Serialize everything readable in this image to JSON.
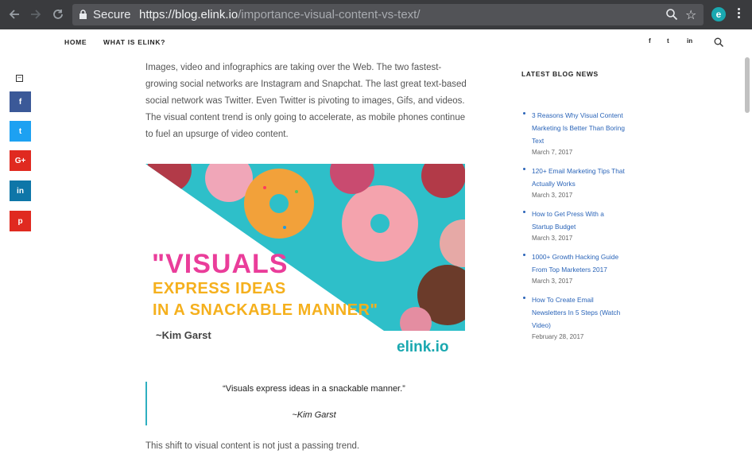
{
  "browser": {
    "secure_label": "Secure",
    "url_host": "https://blog.elink.io",
    "url_path": "/importance-visual-content-vs-text/"
  },
  "site_nav": {
    "links": [
      "HOME",
      "WHAT IS ELINK?"
    ],
    "social": [
      "f",
      "t",
      "in"
    ]
  },
  "share_bar": {
    "buttons": [
      {
        "label": "f",
        "color": "#3b5998"
      },
      {
        "label": "t",
        "color": "#1da1f2"
      },
      {
        "label": "G+",
        "color": "#e02a20"
      },
      {
        "label": "in",
        "color": "#0e76a8"
      },
      {
        "label": "p",
        "color": "#e02a20"
      }
    ]
  },
  "article": {
    "paragraph1": "Images, video and infographics are taking over the Web. The two fastest-growing social networks are Instagram and Snapchat. The last great text-based social network was Twitter. Even Twitter is pivoting to images, Gifs, and videos. The visual content trend is only going to accelerate, as mobile phones continue to fuel an upsurge of video content.",
    "hero": {
      "line1": "\"VISUALS",
      "line2": "EXPRESS IDEAS",
      "line3": "IN A SNACKABLE MANNER\"",
      "author": "~Kim Garst",
      "logo": "elink.io"
    },
    "blockquote_text": "“Visuals express ideas in a snackable manner.”",
    "blockquote_author": "~Kim Garst",
    "paragraph2": "This shift to visual content is not just a passing trend."
  },
  "sidebar": {
    "title": "LATEST BLOG NEWS",
    "items": [
      {
        "title": "3 Reasons Why Visual Content Marketing Is Better Than Boring Text",
        "date": "March 7, 2017"
      },
      {
        "title": "120+ Email Marketing Tips That Actually Works",
        "date": "March 3, 2017"
      },
      {
        "title": "How to Get Press With a Startup Budget",
        "date": "March 3, 2017"
      },
      {
        "title": "1000+ Growth Hacking Guide From Top Marketers 2017",
        "date": "March 3, 2017"
      },
      {
        "title": "How To Create Email Newsletters In 5 Steps (Watch Video)",
        "date": "February 28, 2017"
      }
    ]
  }
}
